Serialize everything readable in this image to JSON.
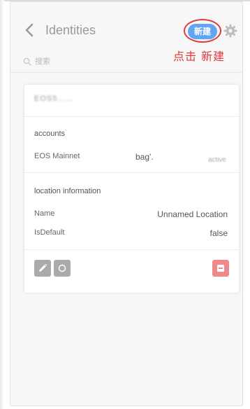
{
  "header": {
    "title": "Identities",
    "new_button_label": "新建"
  },
  "annotation": {
    "text": "点击 新建"
  },
  "search": {
    "placeholder": "搜索"
  },
  "identity": {
    "public_key_masked": "EOS5……"
  },
  "accounts": {
    "section_title": "accounts",
    "network": "EOS Mainnet",
    "account_name_partial": "bag'.",
    "status_partial": "active"
  },
  "location": {
    "section_title": "location information",
    "rows": [
      {
        "label": "Name",
        "value": "Unnamed Location"
      },
      {
        "label": "IsDefault",
        "value": "false"
      }
    ]
  },
  "colors": {
    "accent_blue": "#62a6f2",
    "annotation_red": "#e03a3a",
    "delete_red": "#f08a8a",
    "muted_gray": "#aaaaaa"
  },
  "icons": [
    "chevron-left-icon",
    "gear-icon",
    "search-icon",
    "pencil-icon",
    "circle-icon",
    "minus-icon"
  ]
}
